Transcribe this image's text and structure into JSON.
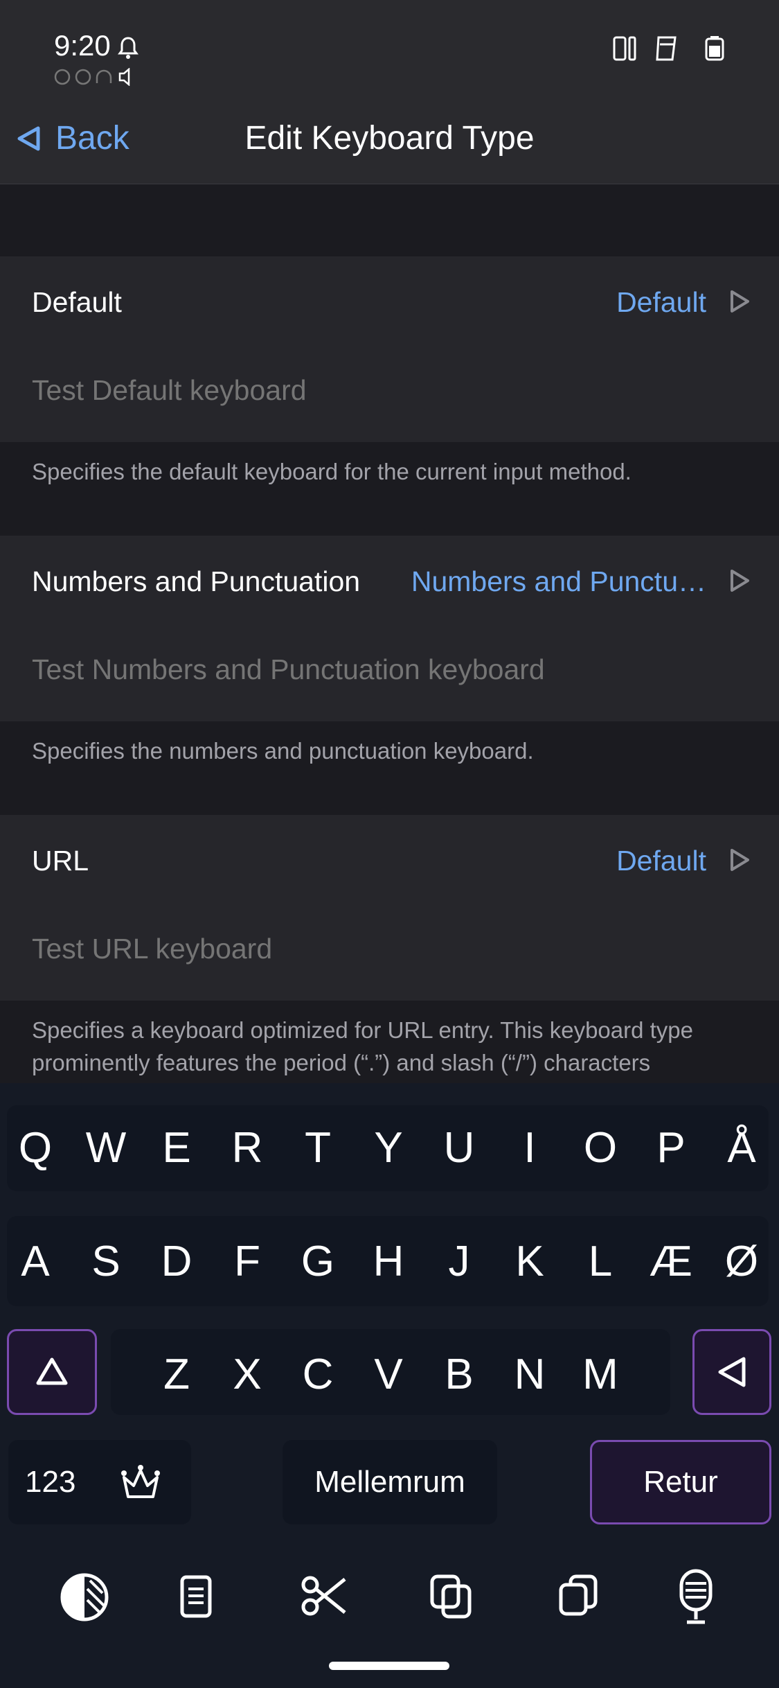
{
  "status_bar": {
    "time": "9:20"
  },
  "nav": {
    "back_label": "Back",
    "title": "Edit Keyboard Type"
  },
  "sections": [
    {
      "label": "Default",
      "value": "Default",
      "test_placeholder": "Test Default keyboard",
      "footnote": "Specifies the default keyboard for the current input method."
    },
    {
      "label": "Numbers and Punctuation",
      "value": "Numbers and Punctu…",
      "test_placeholder": "Test Numbers and Punctuation keyboard",
      "footnote": "Specifies the numbers and punctuation keyboard."
    },
    {
      "label": "URL",
      "value": "Default",
      "test_placeholder": "Test URL keyboard",
      "footnote": "Specifies a keyboard optimized for URL entry. This keyboard type prominently features the period (“.”) and slash (“/”) characters"
    }
  ],
  "keyboard": {
    "row1": [
      "Q",
      "W",
      "E",
      "R",
      "T",
      "Y",
      "U",
      "I",
      "O",
      "P",
      "Å"
    ],
    "row2": [
      "A",
      "S",
      "D",
      "F",
      "G",
      "H",
      "J",
      "K",
      "L",
      "Æ",
      "Ø"
    ],
    "row3": [
      "Z",
      "X",
      "C",
      "V",
      "B",
      "N",
      "M"
    ],
    "numbers_label": "123",
    "space_label": "Mellemrum",
    "return_label": "Retur",
    "accent_color": "#7a4bb0"
  },
  "toolbar_icons": [
    "theme-icon",
    "clipboard-icon",
    "cut-icon",
    "copy-icon",
    "paste-icon",
    "microphone-icon"
  ]
}
